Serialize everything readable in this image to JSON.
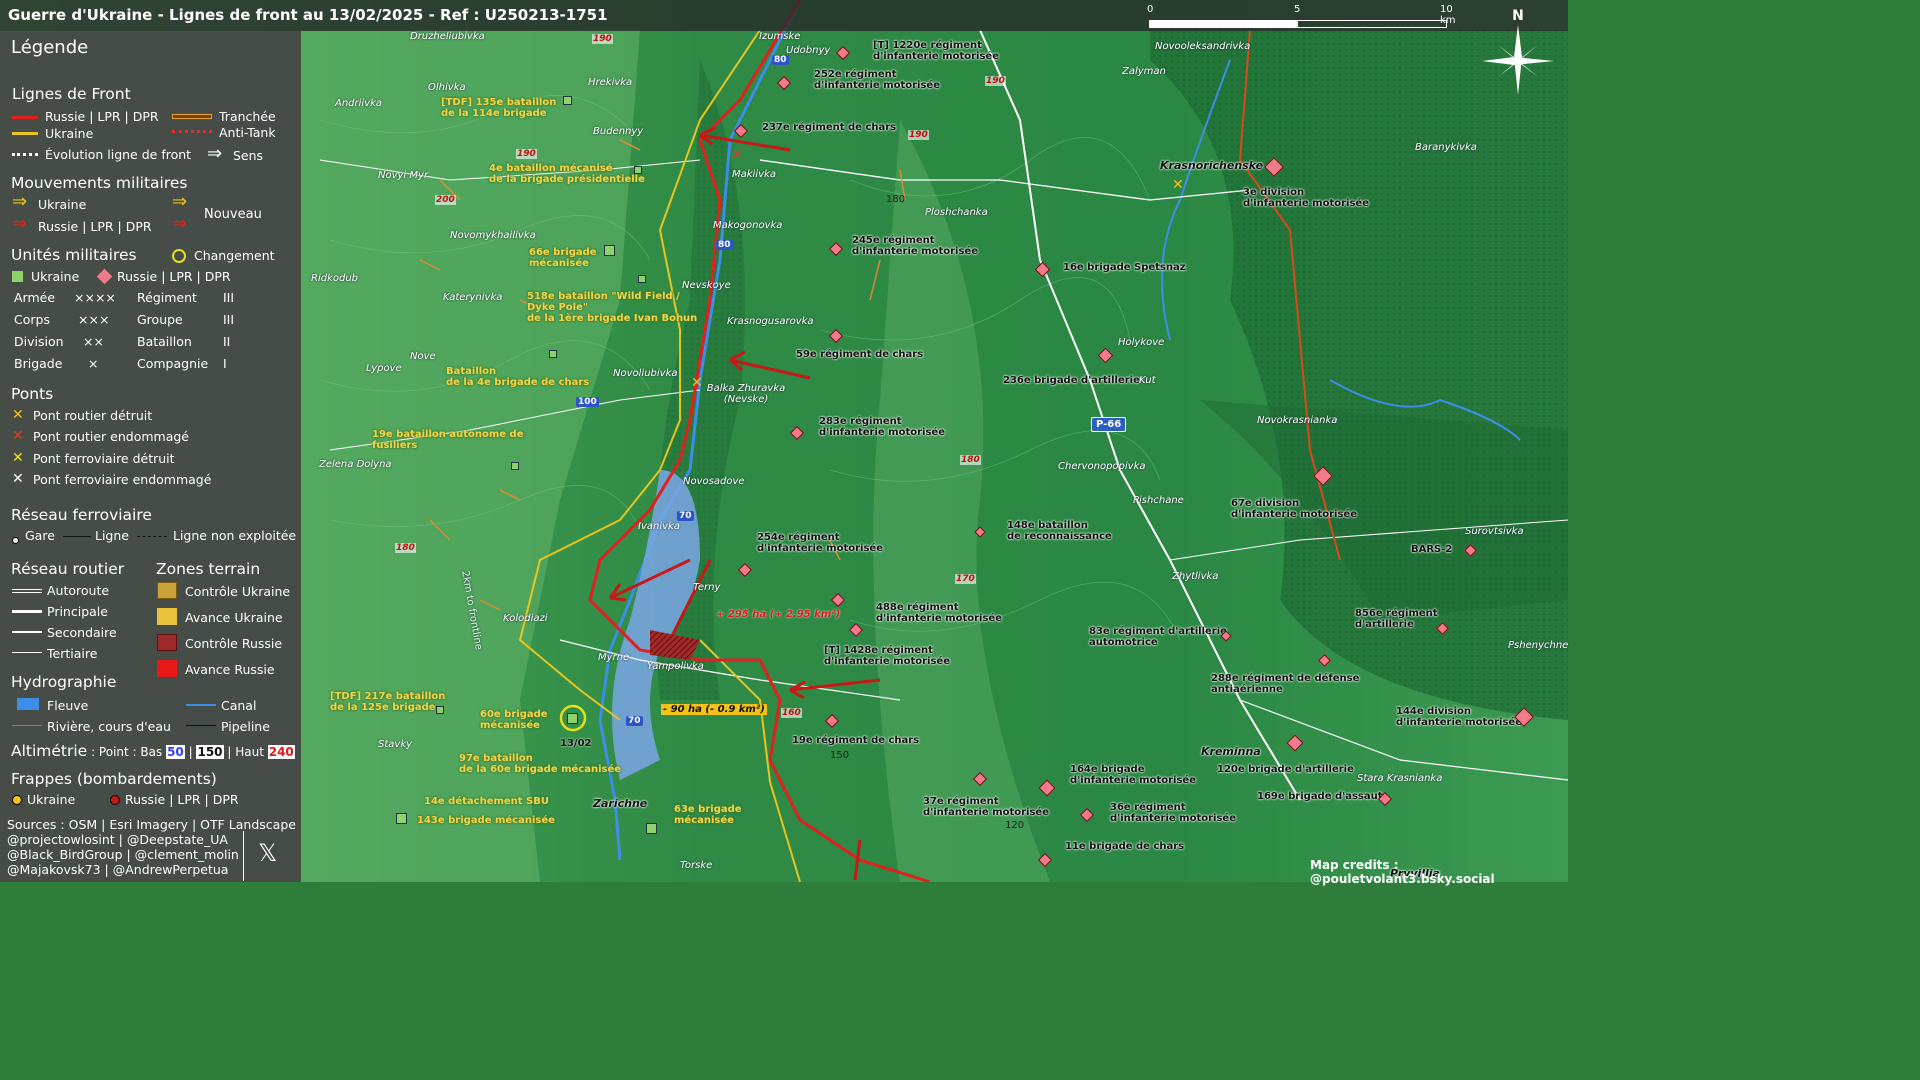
{
  "title": "Guerre d'Ukraine - Lignes de front au 13/02/2025 - Ref : U250213-1751",
  "scale": {
    "ticks": [
      "0",
      "5",
      "10 km"
    ]
  },
  "compass": {
    "label": "N",
    "icon": "compass-rose-icon"
  },
  "legend": {
    "title": "Légende",
    "front_lines": {
      "header": "Lignes de Front",
      "russia": "Russie | LPR | DPR",
      "ukraine": "Ukraine",
      "evolution": "Évolution ligne de front",
      "trench": "Tranchée",
      "antitank": "Anti-Tank",
      "direction": "Sens"
    },
    "movements": {
      "header": "Mouvements militaires",
      "ukraine": "Ukraine",
      "russia": "Russie | LPR | DPR",
      "new": "Nouveau"
    },
    "units": {
      "header": "Unités militaires",
      "change": "Changement",
      "ukraine": "Ukraine",
      "russia": "Russie | LPR | DPR",
      "rows": [
        {
          "a": "Armée",
          "as": "××××",
          "b": "Régiment",
          "bs": "III"
        },
        {
          "a": "Corps",
          "as": "×××",
          "b": "Groupe",
          "bs": "III"
        },
        {
          "a": "Division",
          "as": "××",
          "b": "Bataillon",
          "bs": "II"
        },
        {
          "a": "Brigade",
          "as": "×",
          "b": "Compagnie",
          "bs": "I"
        }
      ]
    },
    "bridges": {
      "header": "Ponts",
      "items": [
        {
          "label": "Pont routier détruit",
          "color": "#f2c21a"
        },
        {
          "label": "Pont routier endommagé",
          "color": "#e23a2a"
        },
        {
          "label": "Pont ferroviaire détruit",
          "color": "#f2e21a"
        },
        {
          "label": "Pont ferroviaire endommagé",
          "color": "#ffffff"
        }
      ]
    },
    "rail": {
      "header": "Réseau ferroviaire",
      "station": "Gare",
      "line": "Ligne",
      "unused": "Ligne non exploitée"
    },
    "roads": {
      "header": "Réseau routier",
      "items": [
        "Autoroute",
        "Principale",
        "Secondaire",
        "Tertiaire"
      ]
    },
    "zones": {
      "header": "Zones terrain",
      "items": [
        {
          "label": "Contrôle Ukraine",
          "color": "#c9a23a"
        },
        {
          "label": "Avance Ukraine",
          "color": "#e8c23a"
        },
        {
          "label": "Contrôle Russie",
          "color": "#a02a2a"
        },
        {
          "label": "Avance Russie",
          "color": "#e81818"
        }
      ]
    },
    "hydro": {
      "header": "Hydrographie",
      "river_body": "Fleuve",
      "stream": "Rivière, cours d'eau",
      "canal": "Canal",
      "pipeline": "Pipeline"
    },
    "altimetry": {
      "header": "Altimétrie",
      "prefix": ": Point : Bas",
      "low": "50",
      "sep1": "|",
      "mid": "150",
      "sep2": "| Haut",
      "high": "240"
    },
    "strikes": {
      "header": "Frappes (bombardements)",
      "ukraine": "Ukraine",
      "russia": "Russie | LPR | DPR"
    },
    "sources": [
      "Sources : OSM | Esri Imagery | OTF Landscape",
      "@projectowlosint | @Deepstate_UA",
      "@Black_BirdGroup | @clement_molin",
      "@Majakovsk73 | @AndrewPerpetua"
    ],
    "x_icon": "x-logo-icon"
  },
  "map": {
    "towns": [
      "Druzheliubivka",
      "Olhivka",
      "Andriivka",
      "Hrekivka",
      "Budennyy",
      "Novyi Myr",
      "Novomykhailivka",
      "Ridkodub",
      "Katerynivka",
      "Lypove",
      "Nove",
      "Zelena Dolyna",
      "Kolodiazi",
      "Stavky",
      "Izumske",
      "Udobnyy",
      "Makiivka",
      "Makogonovka",
      "Nevskoye",
      "Krasnogusarovka",
      "Novoliubivka",
      "Balka Zhuravka (Nevske)",
      "Novosadove",
      "Ivanivka",
      "Terny",
      "Myrne",
      "Yampolivka",
      "Zarichne",
      "Torske",
      "Ploshchanka",
      "Novooleksandrivka",
      "Zalyman",
      "Krasnorichenske",
      "Baranykivka",
      "Holykove",
      "Kut",
      "Chervonopopivka",
      "Pishchane",
      "Novokrasnianka",
      "Zhytlivka",
      "Surovtsivka",
      "Pshenychne",
      "Kreminna",
      "Stara Krasnianka",
      "Pryvillia"
    ],
    "ukraine_units": [
      "[TDF] 135e bataillon\nde la 114e brigade",
      "4e bataillon mécanisé\nde la brigade présidentielle",
      "66e brigade\nmécanisée",
      "518e bataillon \"Wild Field /\nDyke Pole\"\nde la 1ère brigade Ivan Bohun",
      "Bataillon\nde la 4e brigade de chars",
      "19e bataillon autonome de\nfusiliers",
      "[TDF] 217e bataillon\nde la 125e brigade",
      "60e brigade\nmécanisée",
      "97e bataillon\nde la 60e brigade mécanisée",
      "14e détachement SBU",
      "143e brigade mécanisée",
      "63e brigade\nmécanisée"
    ],
    "russia_units": [
      "[T] 1220e régiment\nd'infanterie motorisée",
      "252e régiment\nd'infanterie motorisée",
      "237e régiment de chars",
      "245e régiment\nd'infanterie motorisée",
      "59e régiment de chars",
      "283e régiment\nd'infanterie motorisée",
      "254e régiment\nd'infanterie motorisée",
      "488e régiment\nd'infanterie motorisée",
      "[T] 1428e régiment\nd'infanterie motorisée",
      "19e régiment de chars",
      "37e régiment\nd'infanterie motorisée",
      "164e brigade\nd'infanterie motorisée",
      "36e régiment\nd'infanterie motorisée",
      "11e brigade de chars",
      "3e division\nd'infanterie motorisée",
      "16e brigade Spetsnaz",
      "236e brigade d'artillerie",
      "148e bataillon\nde reconnaissance",
      "83e régiment d'artillerie\nautomotrice",
      "288e régiment de défense\nantiaérienne",
      "120e brigade d'artillerie",
      "169e brigade d'assaut",
      "67e division\nd'infanterie motorisée",
      "BARS-2",
      "856e régiment\nd'artillerie",
      "144e division\nd'infanterie motorisée"
    ],
    "road_numbers": [
      "190",
      "190",
      "190",
      "200",
      "190",
      "100",
      "180",
      "180",
      "170",
      "160",
      "80",
      "80",
      "70",
      "70",
      "180",
      "150",
      "120"
    ],
    "road_badge": "P-66",
    "territory_changes": [
      {
        "label": "+ 295 ha (+ 2.95 km²)",
        "side": "russia"
      },
      {
        "label": "- 90 ha (- 0.9 km²)",
        "side": "ukraine"
      }
    ],
    "change_marker_date": "13/02",
    "frontline_label": "2km to frontline",
    "credits": "Map credits : @pouletvolant3.bsky.social"
  }
}
